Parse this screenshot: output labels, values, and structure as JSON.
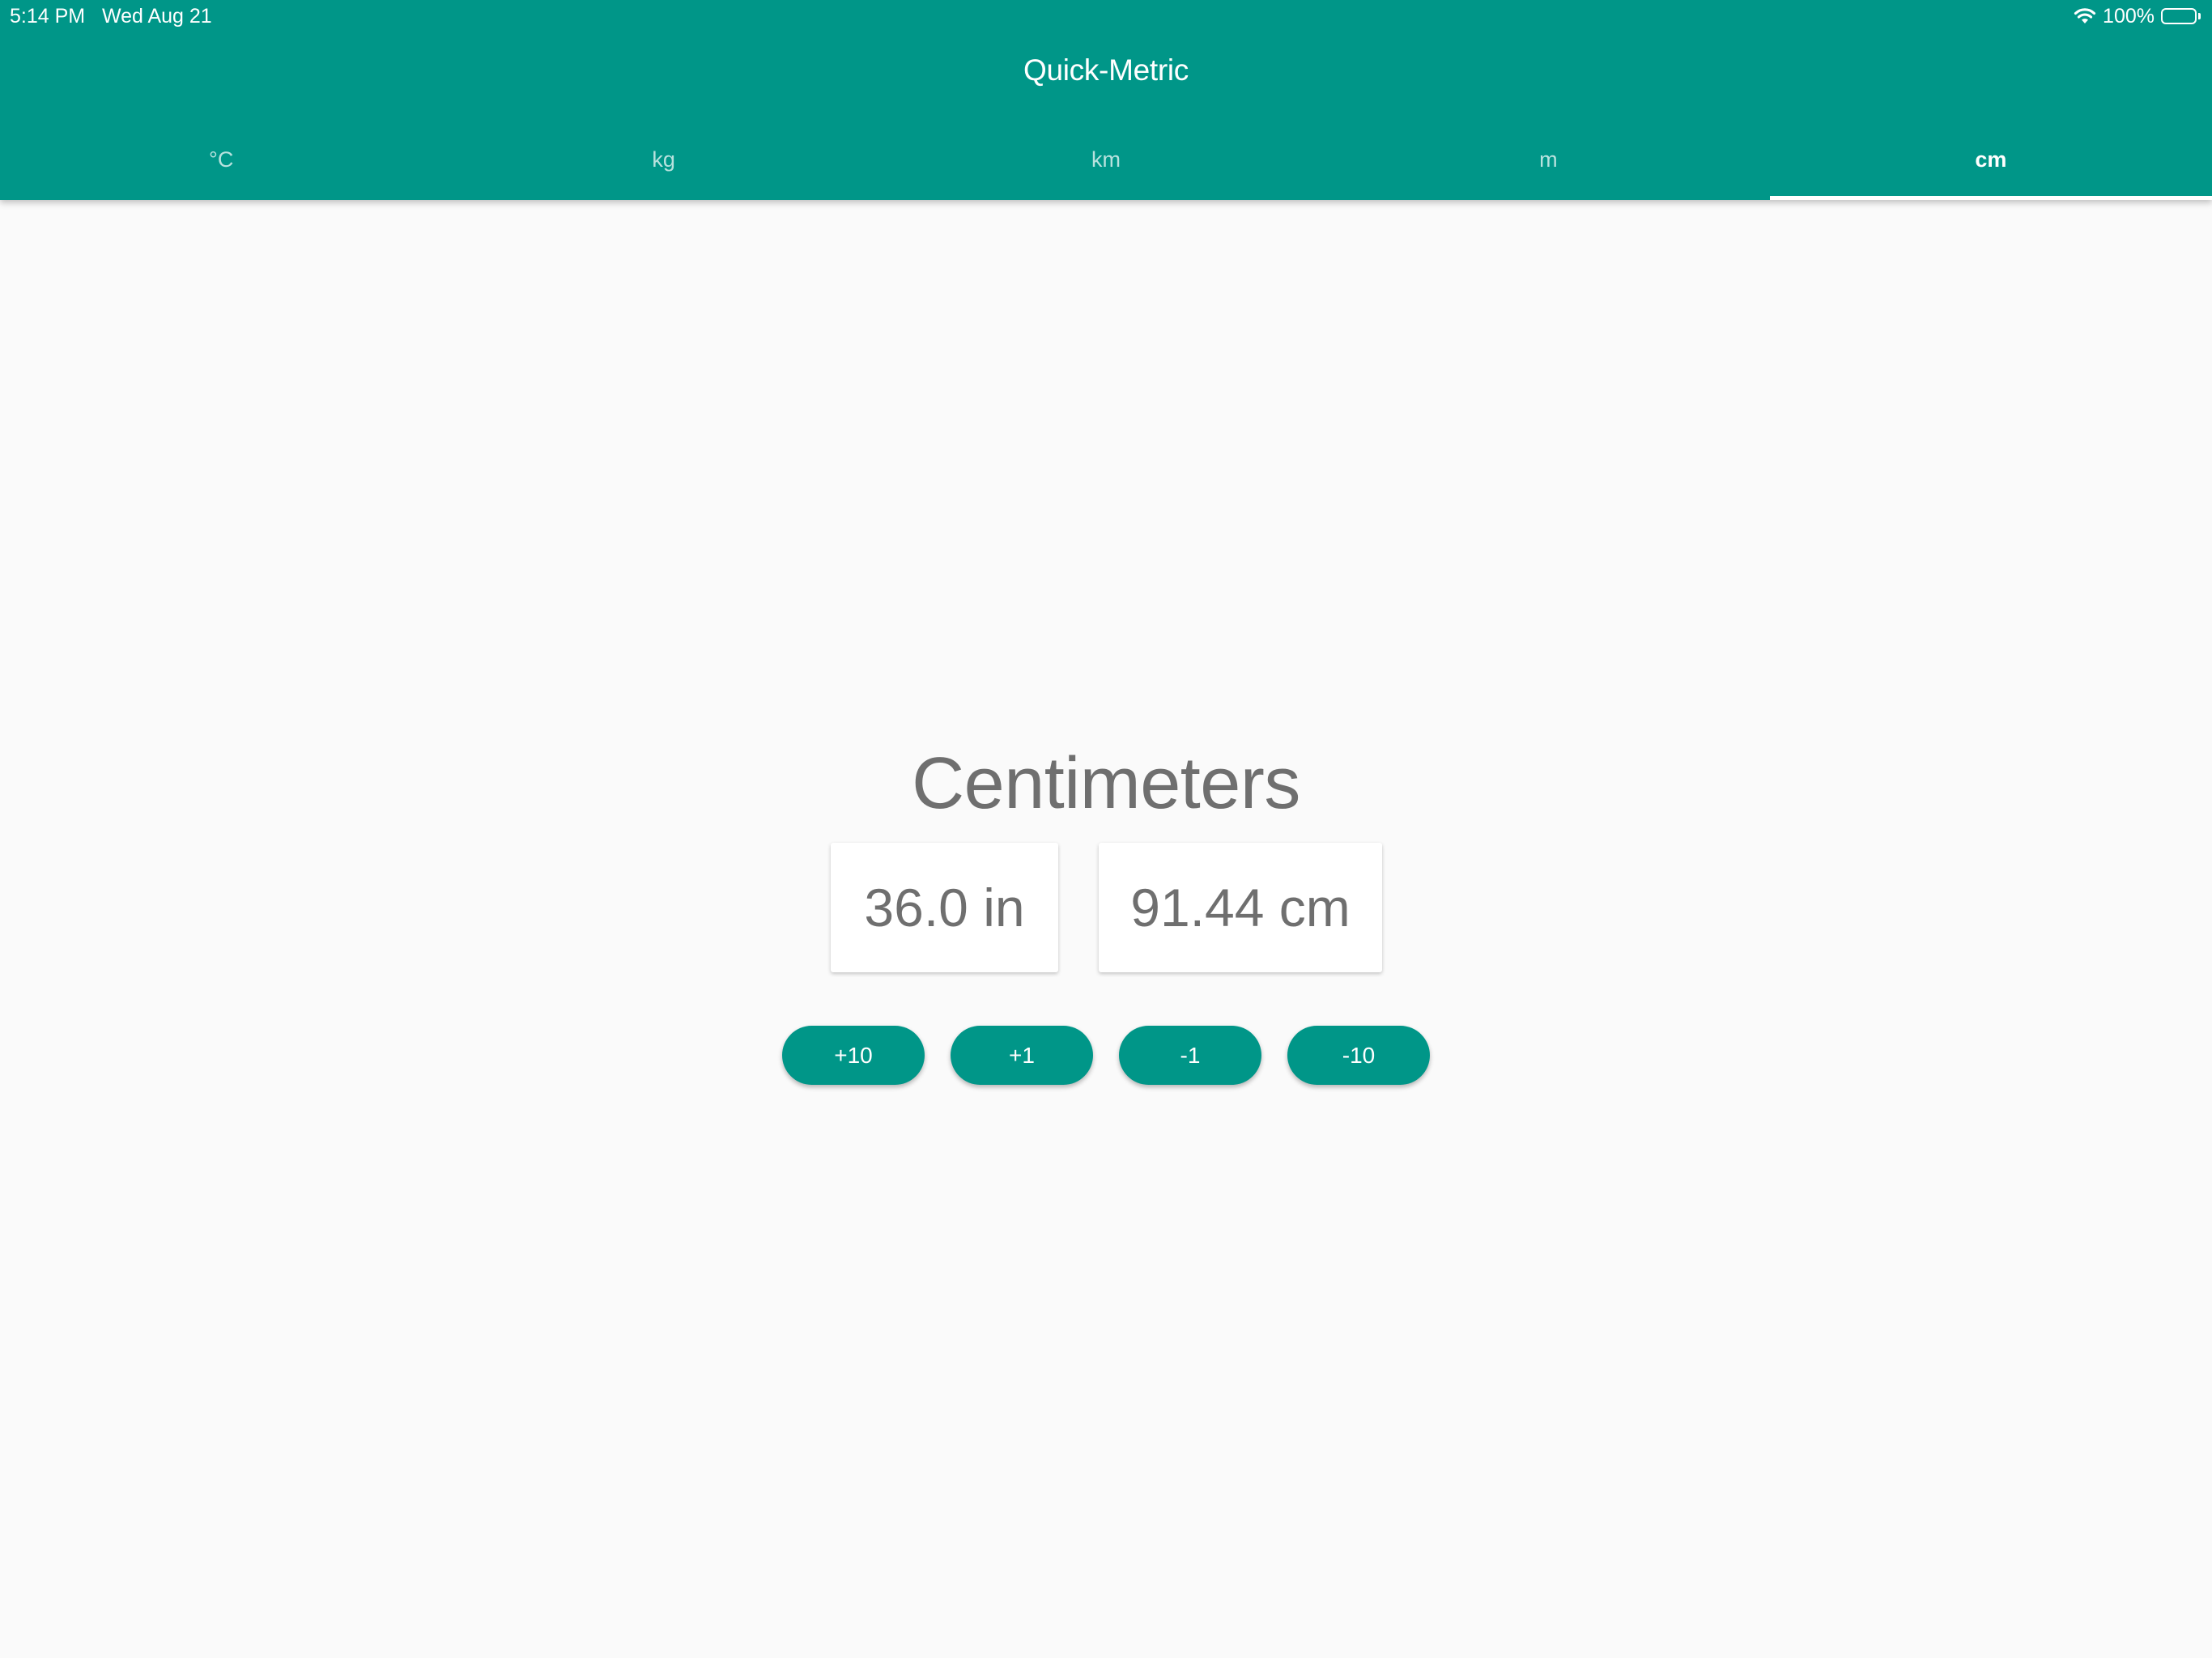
{
  "status_bar": {
    "time": "5:14 PM",
    "date": "Wed Aug 21",
    "battery_text": "100%",
    "battery_level": 1.0,
    "icons": [
      "wifi-icon",
      "battery-icon"
    ]
  },
  "app": {
    "title": "Quick-Metric",
    "accent_color": "#009688",
    "background_color": "#fafafa"
  },
  "tabs": [
    {
      "label": "°C",
      "active": false
    },
    {
      "label": "kg",
      "active": false
    },
    {
      "label": "km",
      "active": false
    },
    {
      "label": "m",
      "active": false
    },
    {
      "label": "cm",
      "active": true
    }
  ],
  "converter": {
    "unit_title": "Centimeters",
    "input_value": "36.0 in",
    "output_value": "91.44 cm"
  },
  "step_buttons": [
    {
      "label": "+10"
    },
    {
      "label": "+1"
    },
    {
      "label": "-1"
    },
    {
      "label": "-10"
    }
  ]
}
